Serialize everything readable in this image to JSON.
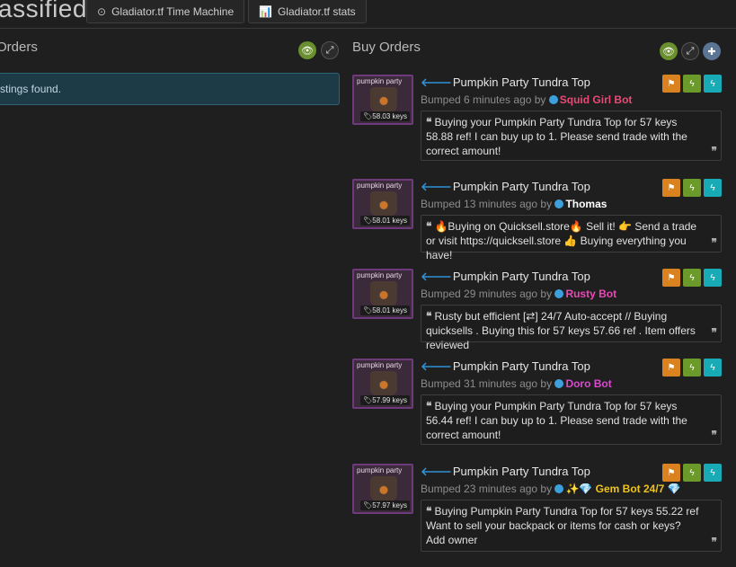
{
  "header": {
    "title": "assifieds",
    "btn_time_machine": "Gladiator.tf Time Machine",
    "btn_stats": "Gladiator.tf stats"
  },
  "sell_panel": {
    "title": "Orders",
    "empty_message": "stings found."
  },
  "buy_panel": {
    "title": "Buy Orders"
  },
  "listings": [
    {
      "thumb_label": "pumpkin party",
      "price": "58.03 keys",
      "item_name": "Pumpkin Party Tundra Top",
      "bumped": "Bumped 6 minutes ago by",
      "user": "Squid Girl Bot",
      "user_color": "#e84a78",
      "message": "Buying your Pumpkin Party Tundra Top for 57 keys 58.88 ref! I can buy up to 1. Please send trade with the correct amount!"
    },
    {
      "thumb_label": "pumpkin party",
      "price": "58.01 keys",
      "item_name": "Pumpkin Party Tundra Top",
      "bumped": "Bumped 13 minutes ago by",
      "user": "Thomas",
      "user_color": "#ffffff",
      "message": "🔥Buying on Quicksell.store🔥 Sell it! 👉 Send a trade or visit https://quicksell.store 👍 Buying everything you have!"
    },
    {
      "thumb_label": "pumpkin party",
      "price": "58.01 keys",
      "item_name": "Pumpkin Party Tundra Top",
      "bumped": "Bumped 29 minutes ago by",
      "user": "Rusty Bot",
      "user_color": "#e84ab5",
      "message": "Rusty but efficient [⇄] 24/7 Auto-accept // Buying quicksells . Buying this for 57 keys 57.66 ref . Item offers reviewed"
    },
    {
      "thumb_label": "pumpkin party",
      "price": "57.99 keys",
      "item_name": "Pumpkin Party Tundra Top",
      "bumped": "Bumped 31 minutes ago by",
      "user": "Doro Bot",
      "user_color": "#d94ad0",
      "message": "Buying your Pumpkin Party Tundra Top for 57 keys 56.44 ref! I can buy up to 1. Please send trade with the correct amount!"
    },
    {
      "thumb_label": "pumpkin party",
      "price": "57.97 keys",
      "item_name": "Pumpkin Party Tundra Top",
      "bumped": "Bumped 23 minutes ago by",
      "user": "✨💎 Gem Bot 24/7 💎",
      "user_color": "#f0c419",
      "message": "Buying Pumpkin Party Tundra Top for 57 keys 55.22 ref Want to sell your backpack or items for cash or keys? Add owner"
    }
  ]
}
